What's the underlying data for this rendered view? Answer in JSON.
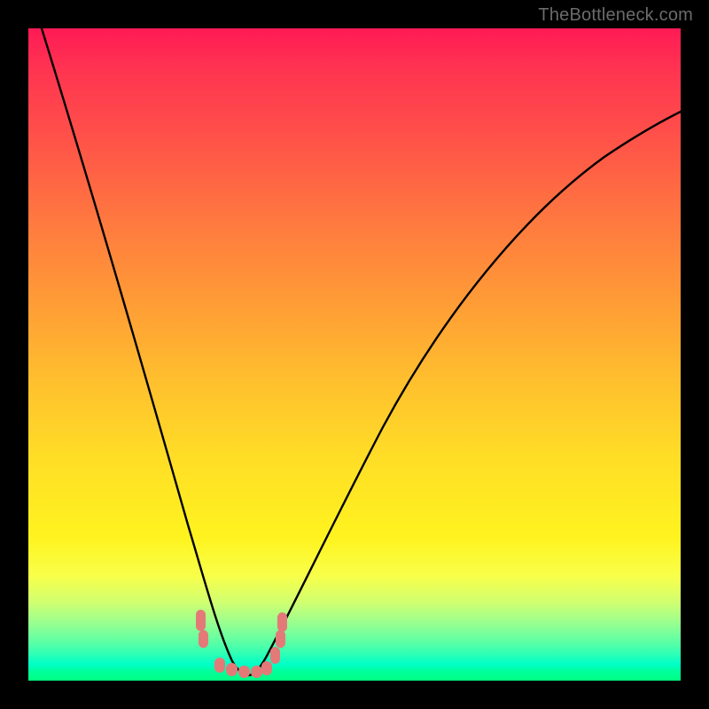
{
  "watermark": "TheBottleneck.com",
  "colors": {
    "frame": "#000000",
    "grad_top": "#ff1a55",
    "grad_mid": "#ffde26",
    "grad_bottom": "#00ff80",
    "curve": "#000000",
    "markers": "#e47a78"
  },
  "chart_data": {
    "type": "line",
    "title": "",
    "xlabel": "",
    "ylabel": "",
    "xlim": [
      0,
      100
    ],
    "ylim": [
      0,
      100
    ],
    "x": [
      2,
      5,
      8,
      11,
      14,
      17,
      20,
      22,
      24,
      26,
      27.5,
      29,
      30.5,
      32,
      33.5,
      35,
      38,
      42,
      46,
      50,
      55,
      60,
      66,
      72,
      78,
      85,
      92,
      100
    ],
    "values": [
      100,
      90,
      80,
      70,
      60,
      50,
      40,
      32,
      24,
      17,
      12,
      8,
      5,
      2.5,
      1.2,
      0.8,
      2,
      6,
      12,
      19,
      28,
      37,
      47,
      56,
      64,
      72,
      78,
      84
    ],
    "markers": {
      "style": "pill",
      "color": "#e47a78",
      "points": [
        {
          "x": 26.5,
          "y": 9
        },
        {
          "x": 26.8,
          "y": 6.5
        },
        {
          "x": 29.5,
          "y": 2.0
        },
        {
          "x": 31.0,
          "y": 1.3
        },
        {
          "x": 32.8,
          "y": 1.0
        },
        {
          "x": 34.5,
          "y": 1.0
        },
        {
          "x": 36.3,
          "y": 1.5
        },
        {
          "x": 37.8,
          "y": 3.5
        },
        {
          "x": 38.7,
          "y": 6.0
        },
        {
          "x": 39.0,
          "y": 8.5
        }
      ]
    },
    "note": "x and y are percentages of the plot area; y=0 at bottom, y=100 at top. Values estimated from pixels."
  }
}
